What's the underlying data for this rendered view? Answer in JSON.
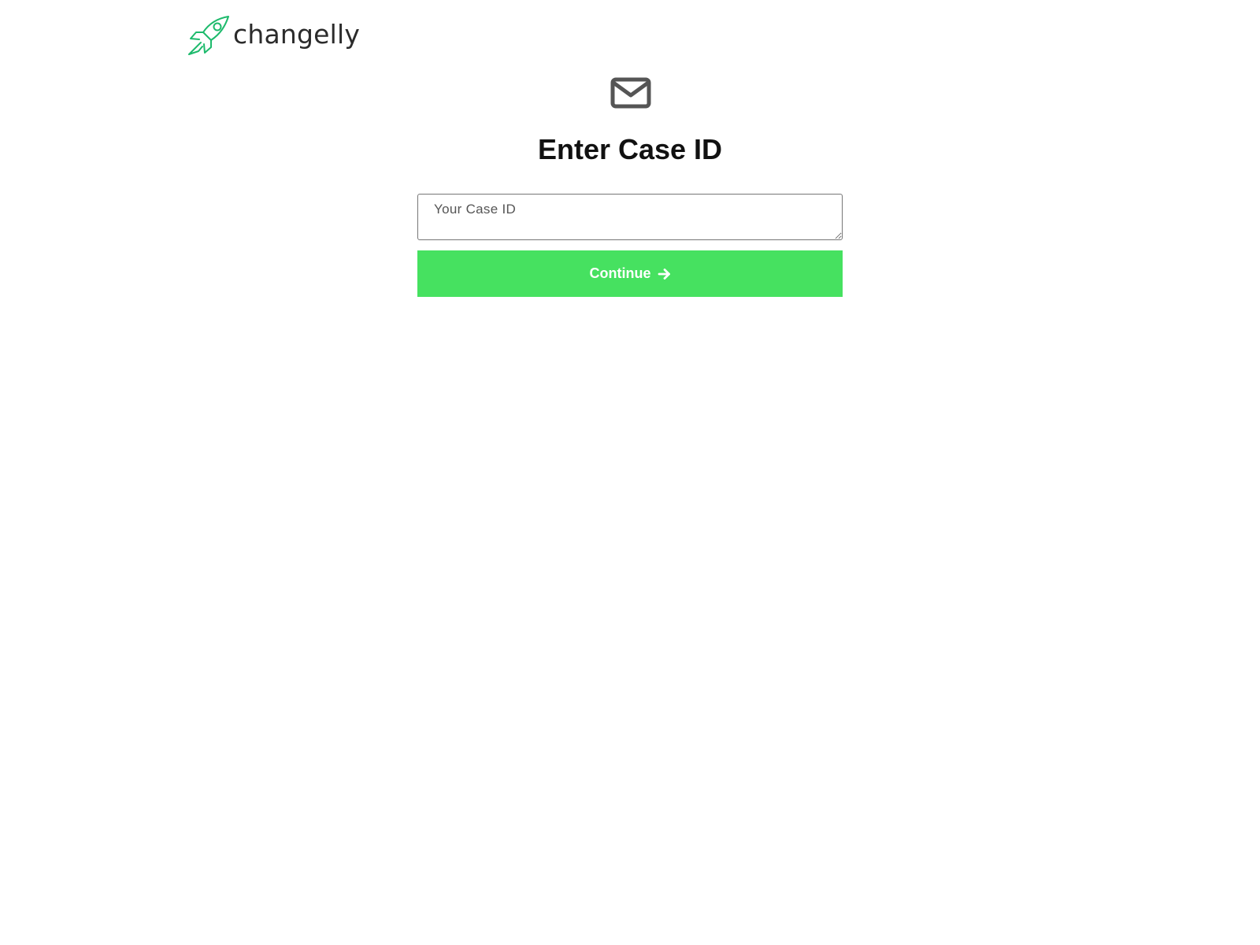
{
  "brand": {
    "name": "changelly",
    "accent_color": "#1dba6c",
    "logo_icon": "rocket-icon"
  },
  "form": {
    "icon": "envelope-icon",
    "title": "Enter Case ID",
    "case_id_placeholder": "Your Case ID",
    "case_id_value": "",
    "continue_label": "Continue",
    "continue_icon": "arrow-right-icon",
    "button_color": "#46e160"
  }
}
